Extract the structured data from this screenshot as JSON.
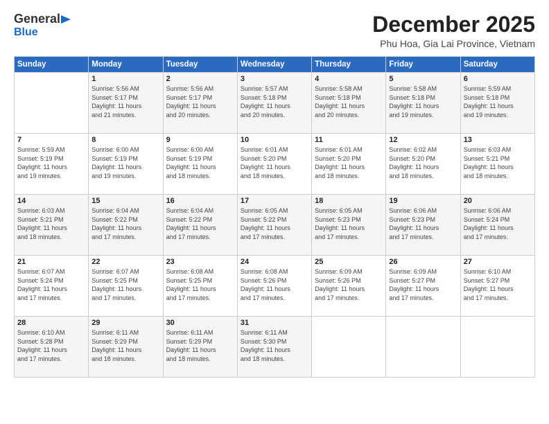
{
  "header": {
    "logo_general": "General",
    "logo_blue": "Blue",
    "month": "December 2025",
    "location": "Phu Hoa, Gia Lai Province, Vietnam"
  },
  "days_of_week": [
    "Sunday",
    "Monday",
    "Tuesday",
    "Wednesday",
    "Thursday",
    "Friday",
    "Saturday"
  ],
  "weeks": [
    [
      {
        "day": "",
        "info": ""
      },
      {
        "day": "1",
        "info": "Sunrise: 5:56 AM\nSunset: 5:17 PM\nDaylight: 11 hours\nand 21 minutes."
      },
      {
        "day": "2",
        "info": "Sunrise: 5:56 AM\nSunset: 5:17 PM\nDaylight: 11 hours\nand 20 minutes."
      },
      {
        "day": "3",
        "info": "Sunrise: 5:57 AM\nSunset: 5:18 PM\nDaylight: 11 hours\nand 20 minutes."
      },
      {
        "day": "4",
        "info": "Sunrise: 5:58 AM\nSunset: 5:18 PM\nDaylight: 11 hours\nand 20 minutes."
      },
      {
        "day": "5",
        "info": "Sunrise: 5:58 AM\nSunset: 5:18 PM\nDaylight: 11 hours\nand 19 minutes."
      },
      {
        "day": "6",
        "info": "Sunrise: 5:59 AM\nSunset: 5:18 PM\nDaylight: 11 hours\nand 19 minutes."
      }
    ],
    [
      {
        "day": "7",
        "info": "Sunrise: 5:59 AM\nSunset: 5:19 PM\nDaylight: 11 hours\nand 19 minutes."
      },
      {
        "day": "8",
        "info": "Sunrise: 6:00 AM\nSunset: 5:19 PM\nDaylight: 11 hours\nand 19 minutes."
      },
      {
        "day": "9",
        "info": "Sunrise: 6:00 AM\nSunset: 5:19 PM\nDaylight: 11 hours\nand 18 minutes."
      },
      {
        "day": "10",
        "info": "Sunrise: 6:01 AM\nSunset: 5:20 PM\nDaylight: 11 hours\nand 18 minutes."
      },
      {
        "day": "11",
        "info": "Sunrise: 6:01 AM\nSunset: 5:20 PM\nDaylight: 11 hours\nand 18 minutes."
      },
      {
        "day": "12",
        "info": "Sunrise: 6:02 AM\nSunset: 5:20 PM\nDaylight: 11 hours\nand 18 minutes."
      },
      {
        "day": "13",
        "info": "Sunrise: 6:03 AM\nSunset: 5:21 PM\nDaylight: 11 hours\nand 18 minutes."
      }
    ],
    [
      {
        "day": "14",
        "info": "Sunrise: 6:03 AM\nSunset: 5:21 PM\nDaylight: 11 hours\nand 18 minutes."
      },
      {
        "day": "15",
        "info": "Sunrise: 6:04 AM\nSunset: 5:22 PM\nDaylight: 11 hours\nand 17 minutes."
      },
      {
        "day": "16",
        "info": "Sunrise: 6:04 AM\nSunset: 5:22 PM\nDaylight: 11 hours\nand 17 minutes."
      },
      {
        "day": "17",
        "info": "Sunrise: 6:05 AM\nSunset: 5:22 PM\nDaylight: 11 hours\nand 17 minutes."
      },
      {
        "day": "18",
        "info": "Sunrise: 6:05 AM\nSunset: 5:23 PM\nDaylight: 11 hours\nand 17 minutes."
      },
      {
        "day": "19",
        "info": "Sunrise: 6:06 AM\nSunset: 5:23 PM\nDaylight: 11 hours\nand 17 minutes."
      },
      {
        "day": "20",
        "info": "Sunrise: 6:06 AM\nSunset: 5:24 PM\nDaylight: 11 hours\nand 17 minutes."
      }
    ],
    [
      {
        "day": "21",
        "info": "Sunrise: 6:07 AM\nSunset: 5:24 PM\nDaylight: 11 hours\nand 17 minutes."
      },
      {
        "day": "22",
        "info": "Sunrise: 6:07 AM\nSunset: 5:25 PM\nDaylight: 11 hours\nand 17 minutes."
      },
      {
        "day": "23",
        "info": "Sunrise: 6:08 AM\nSunset: 5:25 PM\nDaylight: 11 hours\nand 17 minutes."
      },
      {
        "day": "24",
        "info": "Sunrise: 6:08 AM\nSunset: 5:26 PM\nDaylight: 11 hours\nand 17 minutes."
      },
      {
        "day": "25",
        "info": "Sunrise: 6:09 AM\nSunset: 5:26 PM\nDaylight: 11 hours\nand 17 minutes."
      },
      {
        "day": "26",
        "info": "Sunrise: 6:09 AM\nSunset: 5:27 PM\nDaylight: 11 hours\nand 17 minutes."
      },
      {
        "day": "27",
        "info": "Sunrise: 6:10 AM\nSunset: 5:27 PM\nDaylight: 11 hours\nand 17 minutes."
      }
    ],
    [
      {
        "day": "28",
        "info": "Sunrise: 6:10 AM\nSunset: 5:28 PM\nDaylight: 11 hours\nand 17 minutes."
      },
      {
        "day": "29",
        "info": "Sunrise: 6:11 AM\nSunset: 5:29 PM\nDaylight: 11 hours\nand 18 minutes."
      },
      {
        "day": "30",
        "info": "Sunrise: 6:11 AM\nSunset: 5:29 PM\nDaylight: 11 hours\nand 18 minutes."
      },
      {
        "day": "31",
        "info": "Sunrise: 6:11 AM\nSunset: 5:30 PM\nDaylight: 11 hours\nand 18 minutes."
      },
      {
        "day": "",
        "info": ""
      },
      {
        "day": "",
        "info": ""
      },
      {
        "day": "",
        "info": ""
      }
    ]
  ]
}
